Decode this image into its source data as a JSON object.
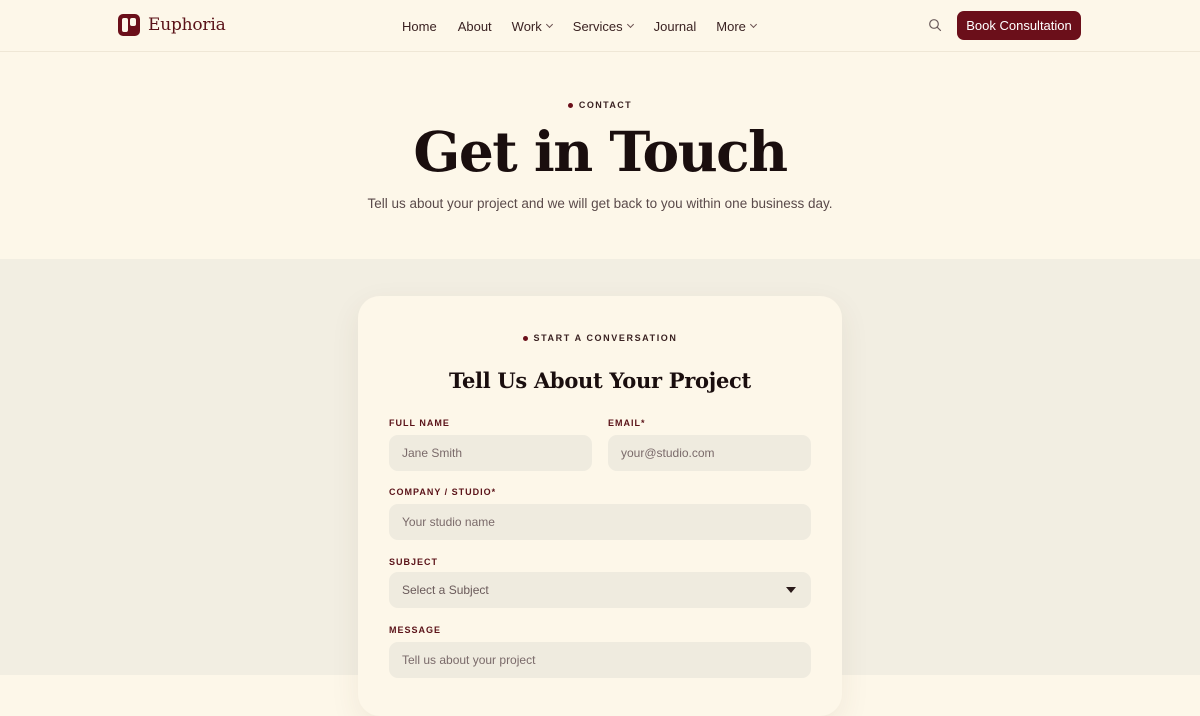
{
  "brand": {
    "name": "Euphoria"
  },
  "nav": {
    "items": [
      {
        "label": "Home",
        "has_dropdown": false
      },
      {
        "label": "About",
        "has_dropdown": false
      },
      {
        "label": "Work",
        "has_dropdown": true
      },
      {
        "label": "Services",
        "has_dropdown": true
      },
      {
        "label": "Journal",
        "has_dropdown": false
      },
      {
        "label": "More",
        "has_dropdown": true
      }
    ],
    "search_icon": "search-icon",
    "cta_label": "Book Consultation"
  },
  "hero": {
    "eyebrow": "CONTACT",
    "title": "Get in Touch",
    "subtitle": "Tell us about your project and we will get back to you within one business day."
  },
  "form": {
    "eyebrow": "START A CONVERSATION",
    "title": "Tell Us About Your Project",
    "full_name": {
      "label": "FULL NAME",
      "placeholder": "Jane Smith"
    },
    "email": {
      "label": "EMAIL*",
      "placeholder": "your@studio.com"
    },
    "company": {
      "label": "COMPANY / STUDIO*",
      "placeholder": "Your studio name"
    },
    "subject": {
      "label": "SUBJECT",
      "selected": "Select a Subject"
    },
    "message": {
      "label": "MESSAGE",
      "placeholder": "Tell us about your project"
    }
  },
  "colors": {
    "accent": "#6b0f1a",
    "page_bg": "#fdf7e9",
    "section_bg": "#f2eee2",
    "field_bg": "#efebdf"
  }
}
